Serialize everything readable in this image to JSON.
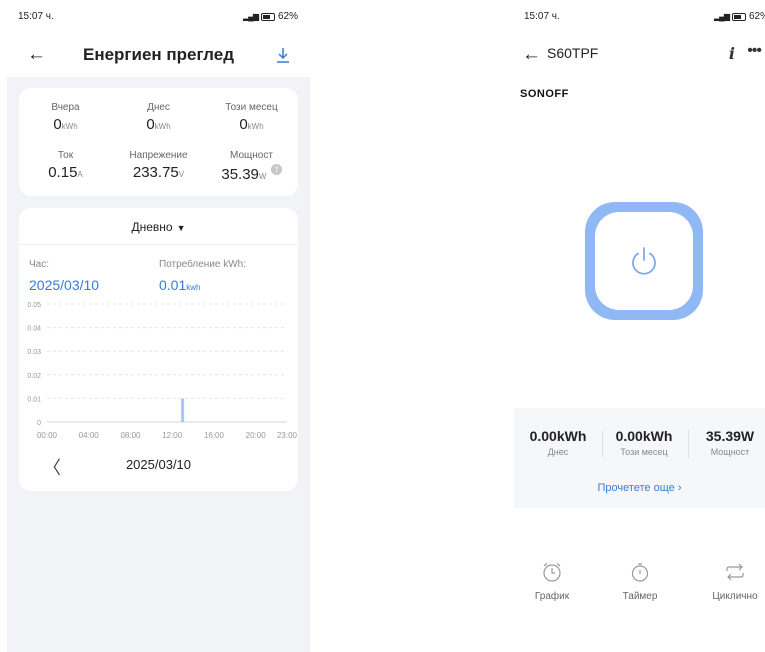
{
  "left": {
    "status": {
      "time": "15:07 ч.",
      "battery": "62%"
    },
    "header": {
      "title": "Енергиен преглед"
    },
    "stats": [
      {
        "label": "Вчера",
        "value": "0",
        "unit": "kWh"
      },
      {
        "label": "Днес",
        "value": "0",
        "unit": "kWh"
      },
      {
        "label": "Този месец",
        "value": "0",
        "unit": "kWh"
      },
      {
        "label": "Ток",
        "value": "0.15",
        "unit": "A"
      },
      {
        "label": "Напрежение",
        "value": "233.75",
        "unit": "V"
      },
      {
        "label": "Мощност",
        "value": "35.39",
        "unit": "W"
      }
    ],
    "chart": {
      "period": "Дневно",
      "hour_label": "Час:",
      "consumption_label": "Потребление kWh:",
      "selected_date": "2025/03/10",
      "selected_value": "0.01",
      "selected_unit": "kwh",
      "date_nav": "2025/03/10"
    }
  },
  "chart_data": {
    "type": "bar",
    "x_tick_labels": [
      "00:00",
      "04:00",
      "08:00",
      "12:00",
      "16:00",
      "20:00",
      "23:00"
    ],
    "y_tick_labels": [
      "0",
      "0.01",
      "0.02",
      "0.03",
      "0.04",
      "0.05"
    ],
    "ylim": [
      0,
      0.05
    ],
    "xlim": [
      0,
      23
    ],
    "grid": true,
    "points": [
      {
        "x": 13,
        "y": 0.01
      }
    ],
    "color": "#a9c6f3"
  },
  "right": {
    "status": {
      "time": "15:07 ч.",
      "battery": "62%"
    },
    "header": {
      "device": "S60TPF"
    },
    "brand": "SONOFF",
    "energy": [
      {
        "value": "0.00kWh",
        "label": "Днес"
      },
      {
        "value": "0.00kWh",
        "label": "Този месец"
      },
      {
        "value": "35.39W",
        "label": "Мощност"
      }
    ],
    "more_link": "Прочетете още",
    "bottom": [
      {
        "label": "График"
      },
      {
        "label": "Таймер"
      },
      {
        "label": "Циклично"
      }
    ]
  },
  "colors": {
    "accent": "#3a7bd5",
    "power_ring": "#8fb8f5",
    "bar": "#a9c6f3"
  }
}
